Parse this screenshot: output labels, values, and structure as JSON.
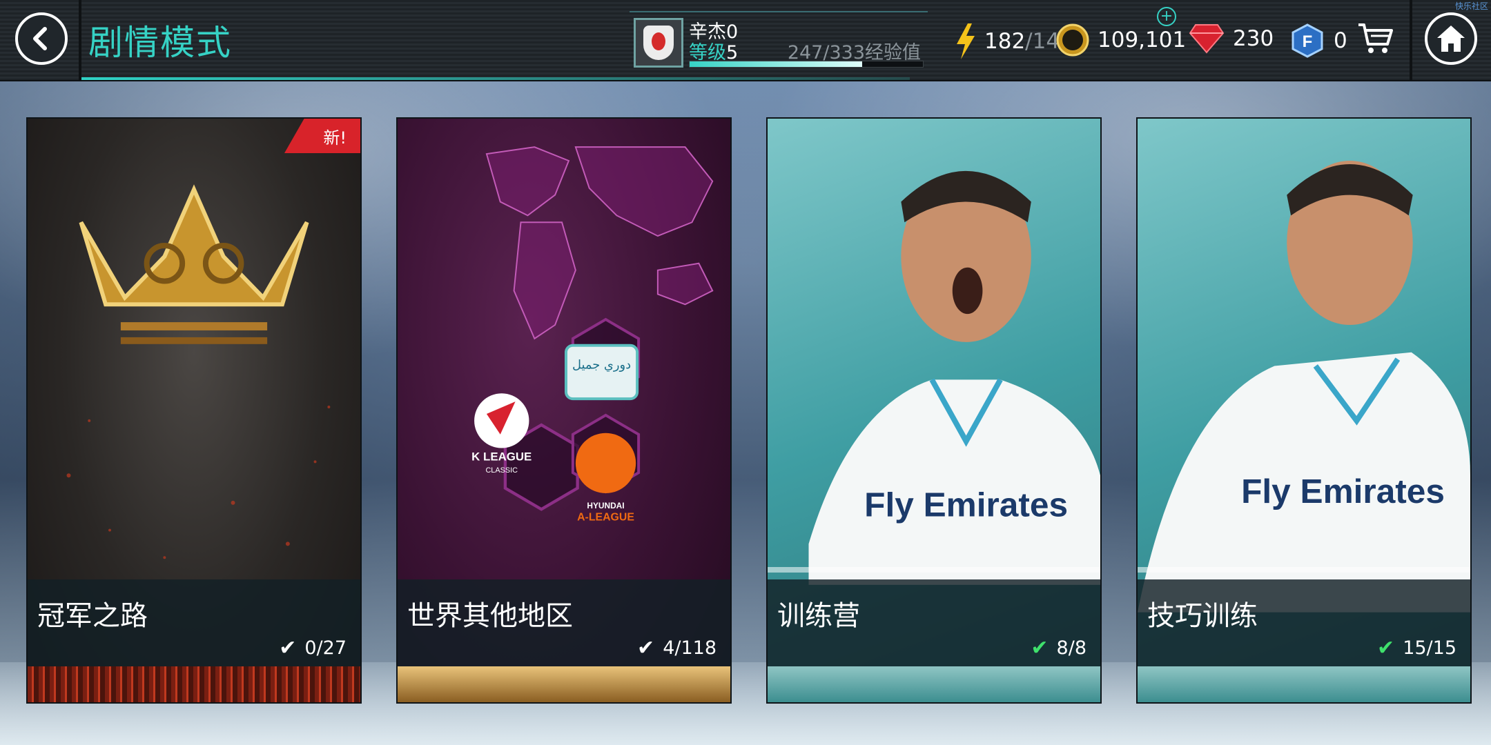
{
  "header": {
    "title": "剧情模式",
    "player_name": "辛杰0",
    "level_label": "等级",
    "level_value": "5",
    "xp_text": "247/333经验值",
    "xp_progress": 0.74,
    "energy_current": "182",
    "energy_max": "/14",
    "coins": "109,101",
    "gems": "230",
    "fifa_points": "0",
    "corner_text": "快乐社区"
  },
  "cards": [
    {
      "title": "冠军之路",
      "progress": "0/27",
      "ribbon": "新!",
      "completed": false
    },
    {
      "title": "世界其他地区",
      "progress": "4/118",
      "completed": false,
      "logos": {
        "k_league_line1": "K LEAGUE",
        "k_league_line2": "CLASSIC",
        "saudi": "دوري جميل",
        "a_league_line1": "HYUNDAI",
        "a_league_line2": "A-LEAGUE"
      }
    },
    {
      "title": "训练营",
      "progress": "8/8",
      "completed": true,
      "jersey_text": "Fly Emirates"
    },
    {
      "title": "技巧训练",
      "progress": "15/15",
      "completed": true,
      "jersey_text": "Fly Emirates"
    }
  ],
  "colors": {
    "accent": "#36d2c5",
    "check_done": "#3fe06c",
    "ribbon": "#d8232a"
  },
  "icons": [
    "back-icon",
    "home-icon",
    "lightning-icon",
    "coin-icon",
    "gem-icon",
    "fifa-points-icon",
    "cart-icon",
    "plus-icon",
    "check-icon",
    "crown-icon",
    "world-map-icon"
  ]
}
